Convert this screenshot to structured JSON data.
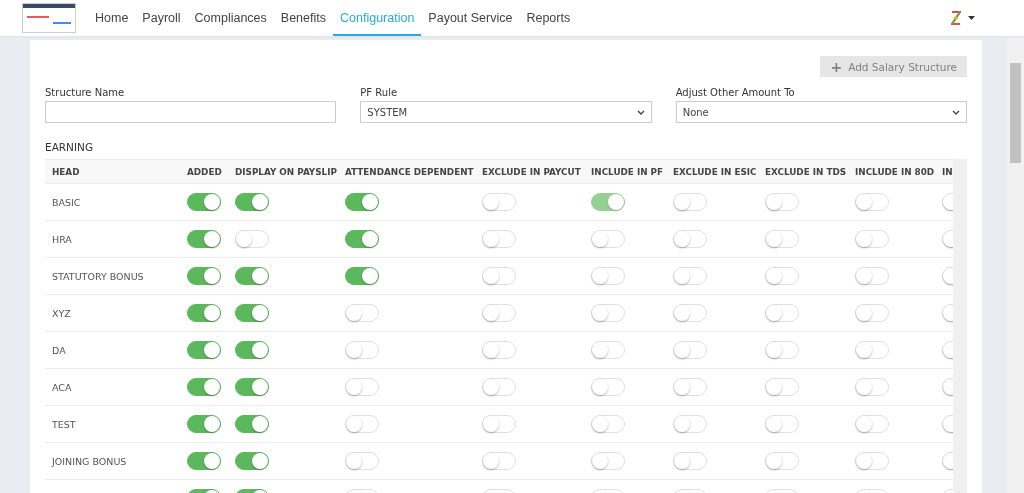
{
  "nav": {
    "items": [
      {
        "label": "Home",
        "selected": false
      },
      {
        "label": "Payroll",
        "selected": false
      },
      {
        "label": "Compliances",
        "selected": false
      },
      {
        "label": "Benefits",
        "selected": false
      },
      {
        "label": "Configuration",
        "selected": true
      },
      {
        "label": "Payout Service",
        "selected": false
      },
      {
        "label": "Reports",
        "selected": false
      }
    ]
  },
  "add_button": {
    "icon": "+",
    "label": "Add Salary Structure",
    "disabled": true
  },
  "form": {
    "structure_name": {
      "label": "Structure Name"
    },
    "pf_rule": {
      "label": "PF Rule",
      "value": "SYSTEM"
    },
    "adjust": {
      "label": "Adjust Other Amount To",
      "value": "None"
    }
  },
  "section_title": "EARNING",
  "table": {
    "columns": [
      "HEAD",
      "ADDED",
      "DISPLAY ON PAYSLIP",
      "ATTENDANCE DEPENDENT",
      "EXCLUDE IN PAYCUT",
      "INCLUDE IN PF",
      "EXCLUDE IN ESIC",
      "EXCLUDE IN TDS",
      "INCLUDE IN 80D",
      "IN"
    ],
    "rows": [
      {
        "head": "BASIC",
        "toggles": [
          {
            "on": true,
            "disabled": false
          },
          {
            "on": true,
            "disabled": false
          },
          {
            "on": true,
            "disabled": false
          },
          {
            "on": false,
            "disabled": false
          },
          {
            "on": true,
            "disabled": true
          },
          {
            "on": false,
            "disabled": false
          },
          {
            "on": false,
            "disabled": false
          },
          {
            "on": false,
            "disabled": false
          },
          {
            "on": false,
            "disabled": false
          }
        ]
      },
      {
        "head": "HRA",
        "toggles": [
          {
            "on": true,
            "disabled": false
          },
          {
            "on": false,
            "disabled": false
          },
          {
            "on": true,
            "disabled": false
          },
          {
            "on": false,
            "disabled": false
          },
          {
            "on": false,
            "disabled": false
          },
          {
            "on": false,
            "disabled": false
          },
          {
            "on": false,
            "disabled": false
          },
          {
            "on": false,
            "disabled": false
          },
          {
            "on": false,
            "disabled": false
          }
        ]
      },
      {
        "head": "STATUTORY BONUS",
        "toggles": [
          {
            "on": true,
            "disabled": false
          },
          {
            "on": true,
            "disabled": false
          },
          {
            "on": true,
            "disabled": false
          },
          {
            "on": false,
            "disabled": false
          },
          {
            "on": false,
            "disabled": false
          },
          {
            "on": false,
            "disabled": false
          },
          {
            "on": false,
            "disabled": false
          },
          {
            "on": false,
            "disabled": false
          },
          {
            "on": false,
            "disabled": false
          }
        ]
      },
      {
        "head": "XYZ",
        "toggles": [
          {
            "on": true,
            "disabled": false
          },
          {
            "on": true,
            "disabled": false
          },
          {
            "on": false,
            "disabled": false
          },
          {
            "on": false,
            "disabled": false
          },
          {
            "on": false,
            "disabled": false
          },
          {
            "on": false,
            "disabled": false
          },
          {
            "on": false,
            "disabled": false
          },
          {
            "on": false,
            "disabled": false
          },
          {
            "on": false,
            "disabled": false
          }
        ]
      },
      {
        "head": "DA",
        "toggles": [
          {
            "on": true,
            "disabled": false
          },
          {
            "on": true,
            "disabled": false
          },
          {
            "on": false,
            "disabled": false
          },
          {
            "on": false,
            "disabled": false
          },
          {
            "on": false,
            "disabled": false
          },
          {
            "on": false,
            "disabled": false
          },
          {
            "on": false,
            "disabled": false
          },
          {
            "on": false,
            "disabled": false
          },
          {
            "on": false,
            "disabled": false
          }
        ]
      },
      {
        "head": "ACA",
        "toggles": [
          {
            "on": true,
            "disabled": false
          },
          {
            "on": true,
            "disabled": false
          },
          {
            "on": false,
            "disabled": false
          },
          {
            "on": false,
            "disabled": false
          },
          {
            "on": false,
            "disabled": false
          },
          {
            "on": false,
            "disabled": false
          },
          {
            "on": false,
            "disabled": false
          },
          {
            "on": false,
            "disabled": false
          },
          {
            "on": false,
            "disabled": false
          }
        ]
      },
      {
        "head": "TEST",
        "toggles": [
          {
            "on": true,
            "disabled": false
          },
          {
            "on": true,
            "disabled": false
          },
          {
            "on": false,
            "disabled": false
          },
          {
            "on": false,
            "disabled": false
          },
          {
            "on": false,
            "disabled": false
          },
          {
            "on": false,
            "disabled": false
          },
          {
            "on": false,
            "disabled": false
          },
          {
            "on": false,
            "disabled": false
          },
          {
            "on": false,
            "disabled": false
          }
        ]
      },
      {
        "head": "JOINING BONUS",
        "toggles": [
          {
            "on": true,
            "disabled": false
          },
          {
            "on": true,
            "disabled": false
          },
          {
            "on": false,
            "disabled": false
          },
          {
            "on": false,
            "disabled": false
          },
          {
            "on": false,
            "disabled": false
          },
          {
            "on": false,
            "disabled": false
          },
          {
            "on": false,
            "disabled": false
          },
          {
            "on": false,
            "disabled": false
          },
          {
            "on": false,
            "disabled": false
          }
        ]
      },
      {
        "toggles": [
          {
            "on": true
          },
          {
            "on": true
          },
          {
            "on": false
          },
          {
            "on": false
          },
          {
            "on": false
          },
          {
            "on": false
          },
          {
            "on": false
          },
          {
            "on": false
          },
          {
            "on": false
          }
        ]
      }
    ]
  }
}
